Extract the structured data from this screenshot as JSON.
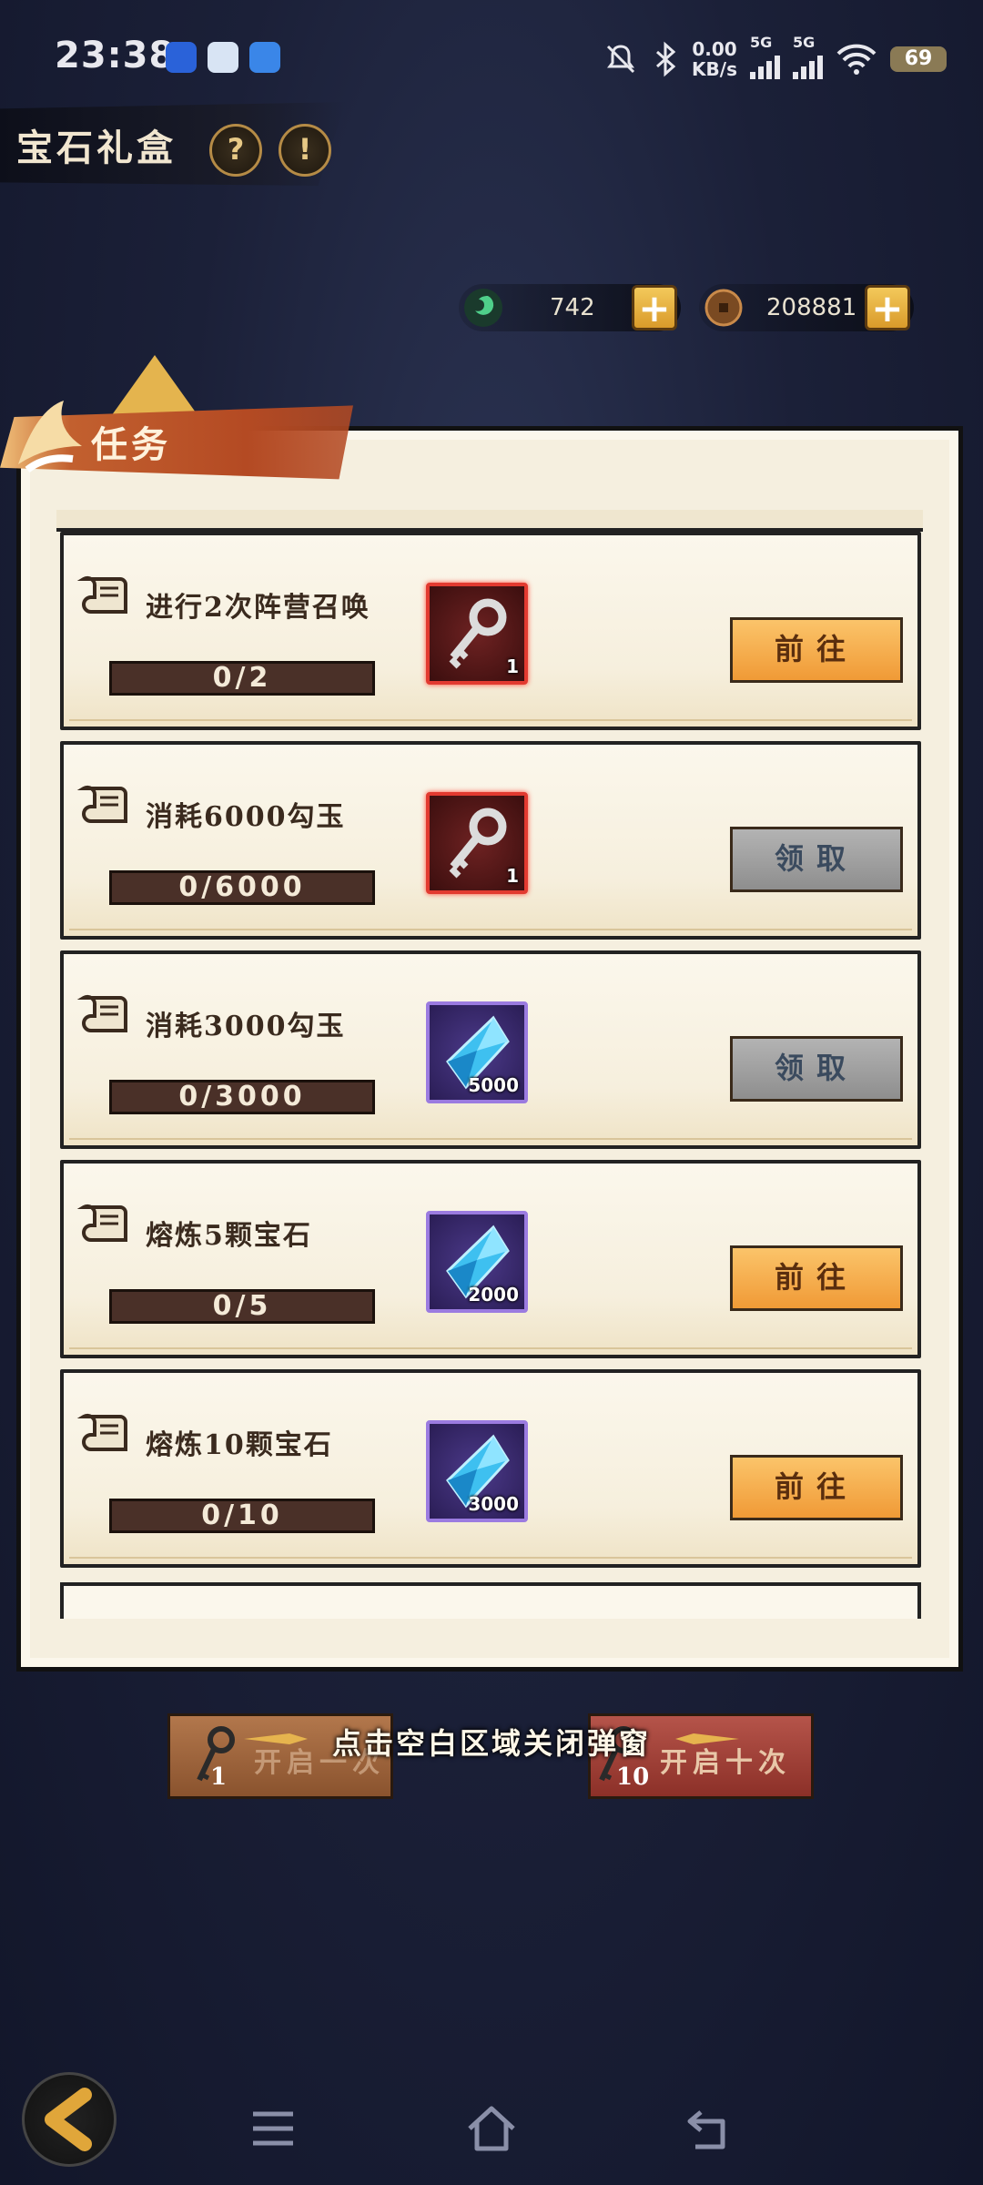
{
  "status_bar": {
    "time": "23:38",
    "net_speed_value": "0.00",
    "net_speed_unit": "KB/s",
    "signal1_label": "5G",
    "signal2_label": "5G",
    "battery": "69"
  },
  "header": {
    "title": "宝石礼盒",
    "help_glyph": "?",
    "info_glyph": "!"
  },
  "currencies": [
    {
      "icon": "magatama-icon",
      "value": "742"
    },
    {
      "icon": "coin-icon",
      "value": "208881"
    }
  ],
  "panel": {
    "tab_label": "任务"
  },
  "tasks": [
    {
      "title": "进行2次阵营召唤",
      "progress": "0/2",
      "reward_type": "key",
      "reward_count": "1",
      "action": "前往",
      "action_state": "go"
    },
    {
      "title": "消耗6000勾玉",
      "progress": "0/6000",
      "reward_type": "key",
      "reward_count": "1",
      "action": "领取",
      "action_state": "claim"
    },
    {
      "title": "消耗3000勾玉",
      "progress": "0/3000",
      "reward_type": "gem",
      "reward_count": "5000",
      "action": "领取",
      "action_state": "claim"
    },
    {
      "title": "熔炼5颗宝石",
      "progress": "0/5",
      "reward_type": "gem",
      "reward_count": "2000",
      "action": "前往",
      "action_state": "go"
    },
    {
      "title": "熔炼10颗宝石",
      "progress": "0/10",
      "reward_type": "gem",
      "reward_count": "3000",
      "action": "前往",
      "action_state": "go"
    }
  ],
  "bottom": {
    "open_one_label": "开启一次",
    "open_one_count": "1",
    "open_ten_label": "开启十次",
    "open_ten_count": "10",
    "close_hint": "点击空白区域关闭弹窗"
  },
  "colors": {
    "go_button": "#f09a36",
    "claim_button": "#8e8e8e",
    "key_frame": "#e23a30",
    "gem_frame": "#9b7be0"
  }
}
